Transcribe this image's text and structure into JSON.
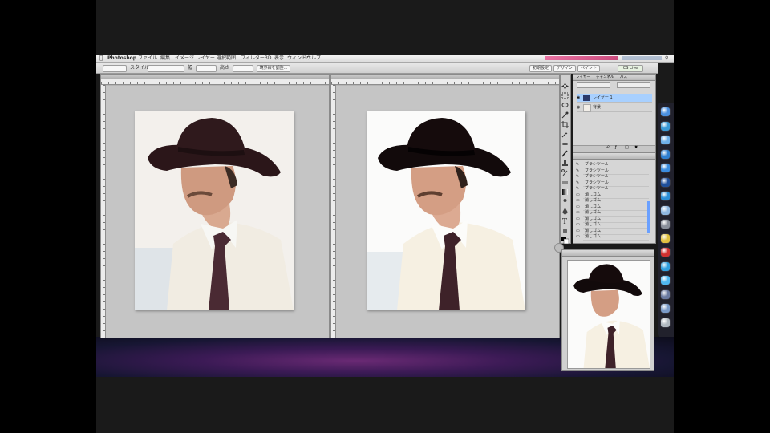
{
  "app": {
    "name": "Photoshop"
  },
  "menubar": {
    "items": [
      "Photoshop",
      "ファイル",
      "編集",
      "イメージ",
      "レイヤー",
      "選択範囲",
      "フィルター",
      "3D",
      "表示",
      "ウィンドウ",
      "ヘルプ"
    ]
  },
  "options_bar": {
    "labels": [
      "スタイル",
      "幅",
      "高さ",
      "境界線を調整..."
    ],
    "workspace_tabs": [
      "初期設定",
      "デザイン",
      "ペイント",
      "CS Live"
    ]
  },
  "documents": [
    {
      "name": "document-before"
    },
    {
      "name": "document-after"
    }
  ],
  "layers_panel": {
    "tabs": [
      "レイヤー",
      "チャンネル",
      "パス"
    ],
    "layers": [
      {
        "name": "レイヤー 1",
        "selected": true
      },
      {
        "name": "背景",
        "selected": false
      }
    ]
  },
  "history_panel": {
    "rows": [
      "ブラシツール",
      "ブラシツール",
      "ブラシツール",
      "ブラシツール",
      "ブラシツール",
      "消しゴム",
      "消しゴム",
      "消しゴム",
      "消しゴム",
      "消しゴム",
      "消しゴム",
      "消しゴム",
      "消しゴム"
    ]
  },
  "colors": {
    "menubar_accent": "#c2185b",
    "selection": "#a8d0ff",
    "desktop": "#4a1f5e"
  },
  "dock": {
    "icons": [
      "finder-icon",
      "safari-icon",
      "mail-icon",
      "itunes-icon",
      "app-store-icon",
      "photoshop-icon",
      "globe-icon",
      "preview-icon",
      "system-prefs-icon",
      "chrome-icon",
      "red-app-icon",
      "skype-icon",
      "twitter-icon",
      "downloads-icon",
      "folder-icon",
      "trash-icon"
    ]
  }
}
